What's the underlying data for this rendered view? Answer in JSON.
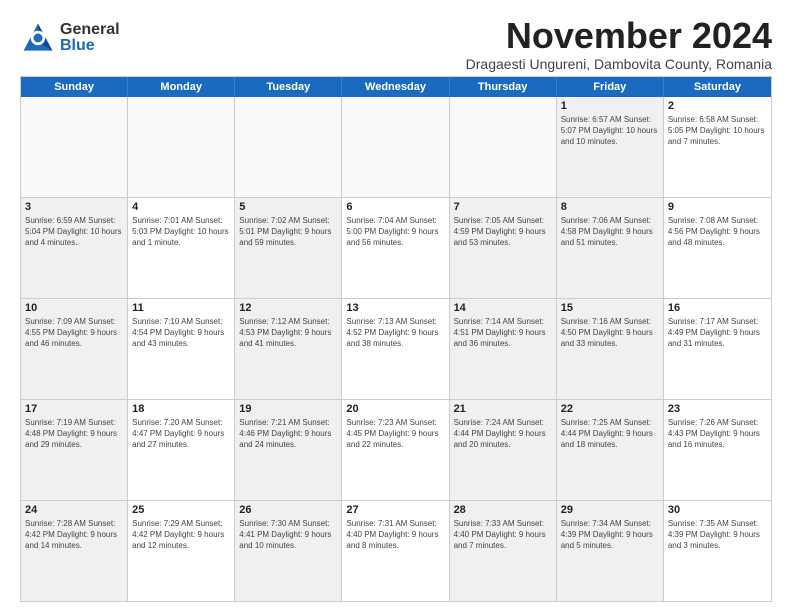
{
  "header": {
    "logo_general": "General",
    "logo_blue": "Blue",
    "month_title": "November 2024",
    "subtitle": "Dragaesti Ungureni, Dambovita County, Romania"
  },
  "days_of_week": [
    "Sunday",
    "Monday",
    "Tuesday",
    "Wednesday",
    "Thursday",
    "Friday",
    "Saturday"
  ],
  "weeks": [
    [
      {
        "day": "",
        "info": "",
        "empty": true
      },
      {
        "day": "",
        "info": "",
        "empty": true
      },
      {
        "day": "",
        "info": "",
        "empty": true
      },
      {
        "day": "",
        "info": "",
        "empty": true
      },
      {
        "day": "",
        "info": "",
        "empty": true
      },
      {
        "day": "1",
        "info": "Sunrise: 6:57 AM\nSunset: 5:07 PM\nDaylight: 10 hours and 10 minutes.",
        "empty": false,
        "shaded": true
      },
      {
        "day": "2",
        "info": "Sunrise: 6:58 AM\nSunset: 5:05 PM\nDaylight: 10 hours and 7 minutes.",
        "empty": false,
        "shaded": false
      }
    ],
    [
      {
        "day": "3",
        "info": "Sunrise: 6:59 AM\nSunset: 5:04 PM\nDaylight: 10 hours and 4 minutes.",
        "empty": false,
        "shaded": true
      },
      {
        "day": "4",
        "info": "Sunrise: 7:01 AM\nSunset: 5:03 PM\nDaylight: 10 hours and 1 minute.",
        "empty": false,
        "shaded": false
      },
      {
        "day": "5",
        "info": "Sunrise: 7:02 AM\nSunset: 5:01 PM\nDaylight: 9 hours and 59 minutes.",
        "empty": false,
        "shaded": true
      },
      {
        "day": "6",
        "info": "Sunrise: 7:04 AM\nSunset: 5:00 PM\nDaylight: 9 hours and 56 minutes.",
        "empty": false,
        "shaded": false
      },
      {
        "day": "7",
        "info": "Sunrise: 7:05 AM\nSunset: 4:59 PM\nDaylight: 9 hours and 53 minutes.",
        "empty": false,
        "shaded": true
      },
      {
        "day": "8",
        "info": "Sunrise: 7:06 AM\nSunset: 4:58 PM\nDaylight: 9 hours and 51 minutes.",
        "empty": false,
        "shaded": true
      },
      {
        "day": "9",
        "info": "Sunrise: 7:08 AM\nSunset: 4:56 PM\nDaylight: 9 hours and 48 minutes.",
        "empty": false,
        "shaded": false
      }
    ],
    [
      {
        "day": "10",
        "info": "Sunrise: 7:09 AM\nSunset: 4:55 PM\nDaylight: 9 hours and 46 minutes.",
        "empty": false,
        "shaded": true
      },
      {
        "day": "11",
        "info": "Sunrise: 7:10 AM\nSunset: 4:54 PM\nDaylight: 9 hours and 43 minutes.",
        "empty": false,
        "shaded": false
      },
      {
        "day": "12",
        "info": "Sunrise: 7:12 AM\nSunset: 4:53 PM\nDaylight: 9 hours and 41 minutes.",
        "empty": false,
        "shaded": true
      },
      {
        "day": "13",
        "info": "Sunrise: 7:13 AM\nSunset: 4:52 PM\nDaylight: 9 hours and 38 minutes.",
        "empty": false,
        "shaded": false
      },
      {
        "day": "14",
        "info": "Sunrise: 7:14 AM\nSunset: 4:51 PM\nDaylight: 9 hours and 36 minutes.",
        "empty": false,
        "shaded": true
      },
      {
        "day": "15",
        "info": "Sunrise: 7:16 AM\nSunset: 4:50 PM\nDaylight: 9 hours and 33 minutes.",
        "empty": false,
        "shaded": true
      },
      {
        "day": "16",
        "info": "Sunrise: 7:17 AM\nSunset: 4:49 PM\nDaylight: 9 hours and 31 minutes.",
        "empty": false,
        "shaded": false
      }
    ],
    [
      {
        "day": "17",
        "info": "Sunrise: 7:19 AM\nSunset: 4:48 PM\nDaylight: 9 hours and 29 minutes.",
        "empty": false,
        "shaded": true
      },
      {
        "day": "18",
        "info": "Sunrise: 7:20 AM\nSunset: 4:47 PM\nDaylight: 9 hours and 27 minutes.",
        "empty": false,
        "shaded": false
      },
      {
        "day": "19",
        "info": "Sunrise: 7:21 AM\nSunset: 4:46 PM\nDaylight: 9 hours and 24 minutes.",
        "empty": false,
        "shaded": true
      },
      {
        "day": "20",
        "info": "Sunrise: 7:23 AM\nSunset: 4:45 PM\nDaylight: 9 hours and 22 minutes.",
        "empty": false,
        "shaded": false
      },
      {
        "day": "21",
        "info": "Sunrise: 7:24 AM\nSunset: 4:44 PM\nDaylight: 9 hours and 20 minutes.",
        "empty": false,
        "shaded": true
      },
      {
        "day": "22",
        "info": "Sunrise: 7:25 AM\nSunset: 4:44 PM\nDaylight: 9 hours and 18 minutes.",
        "empty": false,
        "shaded": true
      },
      {
        "day": "23",
        "info": "Sunrise: 7:26 AM\nSunset: 4:43 PM\nDaylight: 9 hours and 16 minutes.",
        "empty": false,
        "shaded": false
      }
    ],
    [
      {
        "day": "24",
        "info": "Sunrise: 7:28 AM\nSunset: 4:42 PM\nDaylight: 9 hours and 14 minutes.",
        "empty": false,
        "shaded": true
      },
      {
        "day": "25",
        "info": "Sunrise: 7:29 AM\nSunset: 4:42 PM\nDaylight: 9 hours and 12 minutes.",
        "empty": false,
        "shaded": false
      },
      {
        "day": "26",
        "info": "Sunrise: 7:30 AM\nSunset: 4:41 PM\nDaylight: 9 hours and 10 minutes.",
        "empty": false,
        "shaded": true
      },
      {
        "day": "27",
        "info": "Sunrise: 7:31 AM\nSunset: 4:40 PM\nDaylight: 9 hours and 8 minutes.",
        "empty": false,
        "shaded": false
      },
      {
        "day": "28",
        "info": "Sunrise: 7:33 AM\nSunset: 4:40 PM\nDaylight: 9 hours and 7 minutes.",
        "empty": false,
        "shaded": true
      },
      {
        "day": "29",
        "info": "Sunrise: 7:34 AM\nSunset: 4:39 PM\nDaylight: 9 hours and 5 minutes.",
        "empty": false,
        "shaded": true
      },
      {
        "day": "30",
        "info": "Sunrise: 7:35 AM\nSunset: 4:39 PM\nDaylight: 9 hours and 3 minutes.",
        "empty": false,
        "shaded": false
      }
    ]
  ]
}
